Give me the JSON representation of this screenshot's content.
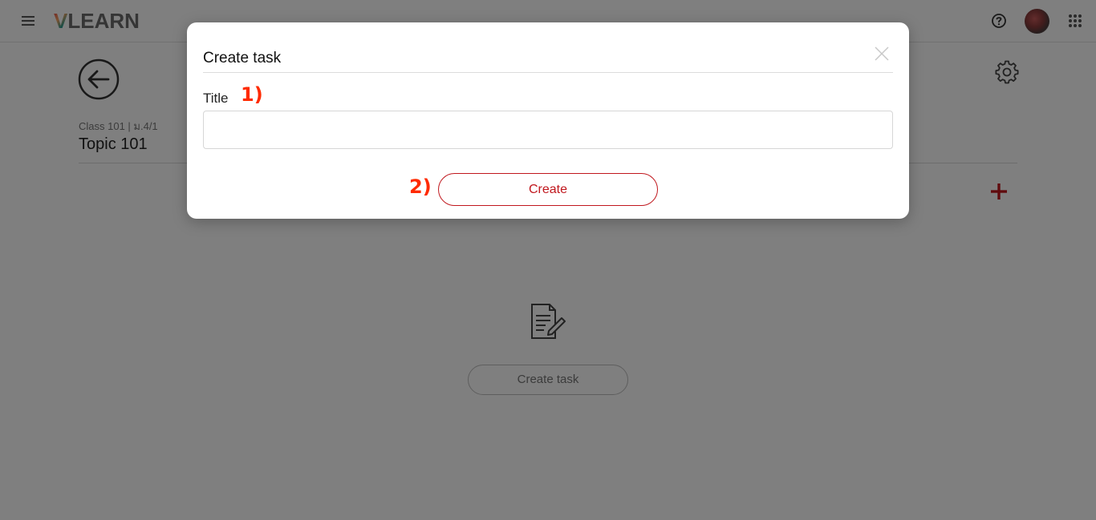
{
  "header": {
    "logo_v": "V",
    "logo_rest": "LEARN"
  },
  "page": {
    "breadcrumb": "Class 101 | ม.4/1",
    "title": "Topic 101",
    "create_task_label": "Create task"
  },
  "modal": {
    "title": "Create task",
    "field_label": "Title",
    "title_value": "",
    "title_placeholder": "",
    "create_label": "Create"
  },
  "annotations": {
    "step1": "1)",
    "step2": "2)"
  },
  "colors": {
    "accent": "#c0171d",
    "annotation": "#ff2a00",
    "overlay": "rgba(0,0,0,0.5)"
  },
  "icons": [
    "menu-icon",
    "help-icon",
    "apps-icon",
    "back-arrow-icon",
    "gear-icon",
    "plus-icon",
    "task-document-icon",
    "close-icon"
  ]
}
